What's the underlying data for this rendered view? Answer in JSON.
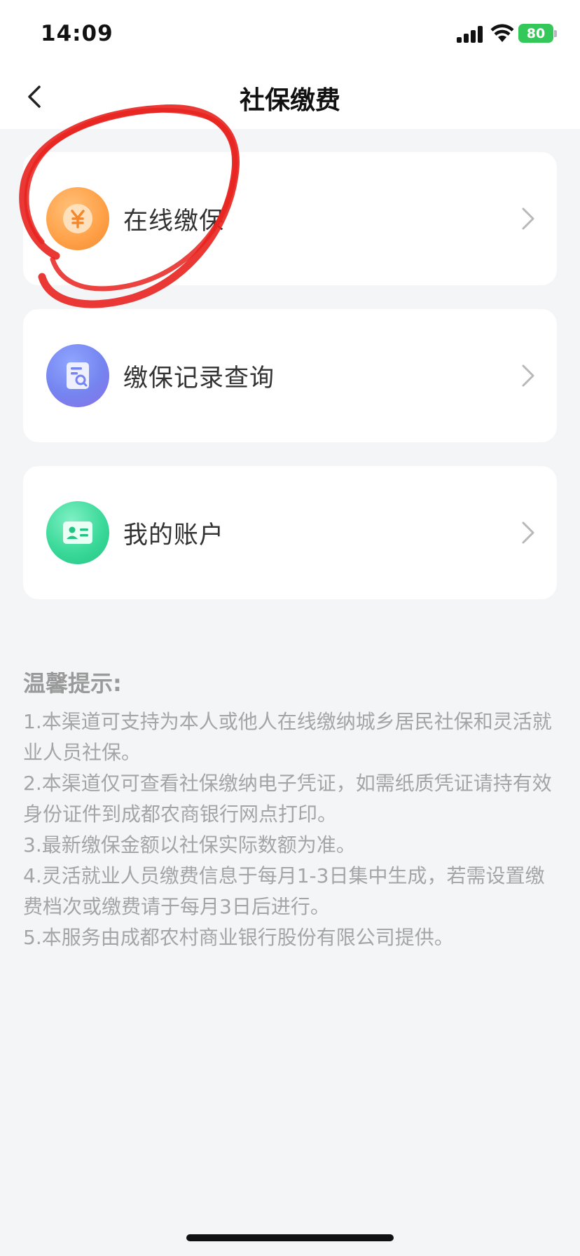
{
  "status_bar": {
    "time": "14:09",
    "battery": "80"
  },
  "nav": {
    "title": "社保缴费"
  },
  "cards": [
    {
      "label": "在线缴保",
      "icon": "yen-coin-icon"
    },
    {
      "label": "缴保记录查询",
      "icon": "document-search-icon"
    },
    {
      "label": "我的账户",
      "icon": "id-card-icon"
    }
  ],
  "tips": {
    "title": "温馨提示:",
    "items": [
      "1.本渠道可支持为本人或他人在线缴纳城乡居民社保和灵活就业人员社保。",
      "2.本渠道仅可查看社保缴纳电子凭证，如需纸质凭证请持有效身份证件到成都农商银行网点打印。",
      "3.最新缴保金额以社保实际数额为准。",
      "4.灵活就业人员缴费信息于每月1-3日集中生成，若需设置缴费档次或缴费请于每月3日后进行。",
      "5.本服务由成都农村商业银行股份有限公司提供。"
    ]
  },
  "colors": {
    "accent_orange": "#ffa24a",
    "accent_purple": "#7584f0",
    "accent_green": "#3bd99a",
    "battery_green": "#34c759",
    "annotation_red": "#e8231f"
  }
}
